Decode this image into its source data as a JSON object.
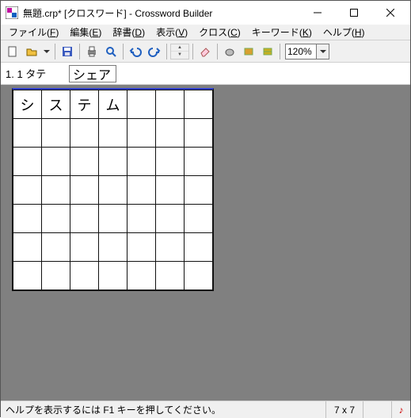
{
  "title": "無題.crp* [クロスワード] - Crossword Builder",
  "menu": {
    "file": {
      "label": "ファイル",
      "mn": "F"
    },
    "edit": {
      "label": "編集",
      "mn": "E"
    },
    "dict": {
      "label": "辞書",
      "mn": "D"
    },
    "view": {
      "label": "表示",
      "mn": "V"
    },
    "cross": {
      "label": "クロス",
      "mn": "C"
    },
    "keyword": {
      "label": "キーワード",
      "mn": "K"
    },
    "help": {
      "label": "ヘルプ",
      "mn": "H"
    }
  },
  "toolbar": {
    "zoom_value": "120%"
  },
  "clue": {
    "label": "1. 1 タテ",
    "value": "シェア"
  },
  "grid": {
    "rows": 7,
    "cols": 7,
    "cells": [
      [
        "シ",
        "ス",
        "テ",
        "ム",
        "",
        "",
        ""
      ],
      [
        "",
        "",
        "",
        "",
        "",
        "",
        ""
      ],
      [
        "",
        "",
        "",
        "",
        "",
        "",
        ""
      ],
      [
        "",
        "",
        "",
        "",
        "",
        "",
        ""
      ],
      [
        "",
        "",
        "",
        "",
        "",
        "",
        ""
      ],
      [
        "",
        "",
        "",
        "",
        "",
        "",
        ""
      ],
      [
        "",
        "",
        "",
        "",
        "",
        "",
        ""
      ]
    ]
  },
  "status": {
    "text": "ヘルプを表示するには F1 キーを押してください。",
    "dims": "7 x 7"
  }
}
